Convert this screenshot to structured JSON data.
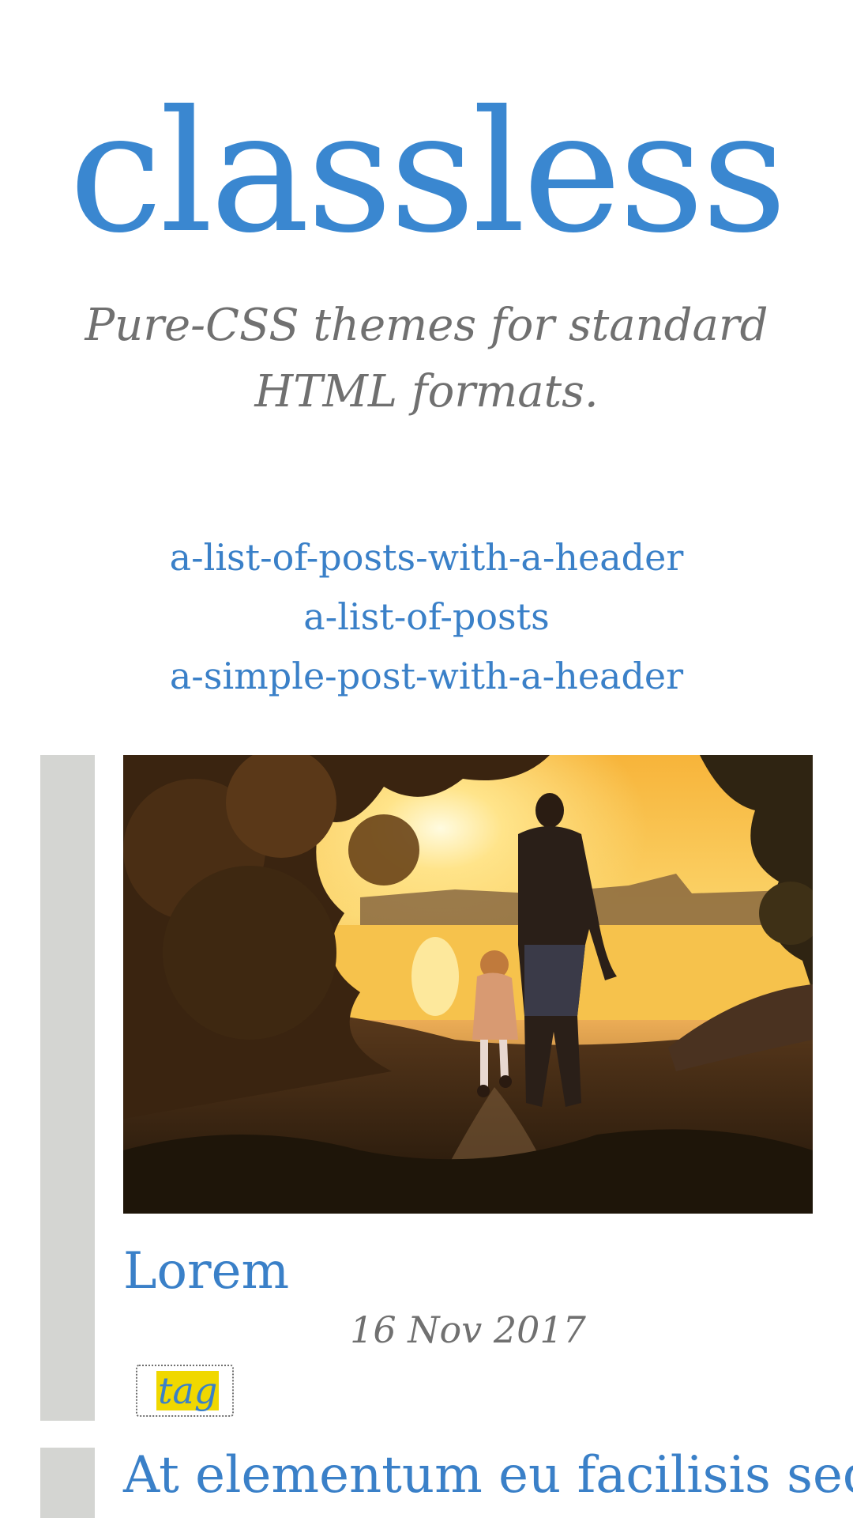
{
  "site": {
    "title": "classless",
    "tagline": "Pure-CSS themes for standard HTML formats."
  },
  "nav": {
    "links": [
      "a-list-of-posts-with-a-header",
      "a-list-of-posts",
      "a-simple-post-with-a-header"
    ]
  },
  "posts": [
    {
      "title": "Lorem",
      "date": "16 Nov 2017",
      "tag": "tag",
      "image": "sunset-father-child-walking-photo"
    },
    {
      "title": "At elementum eu facilisis sed"
    }
  ],
  "colors": {
    "accent": "#3a80c8",
    "muted_text": "#707070",
    "sidebar_bar": "#d4d5d2",
    "tag_highlight": "#f0d800"
  }
}
